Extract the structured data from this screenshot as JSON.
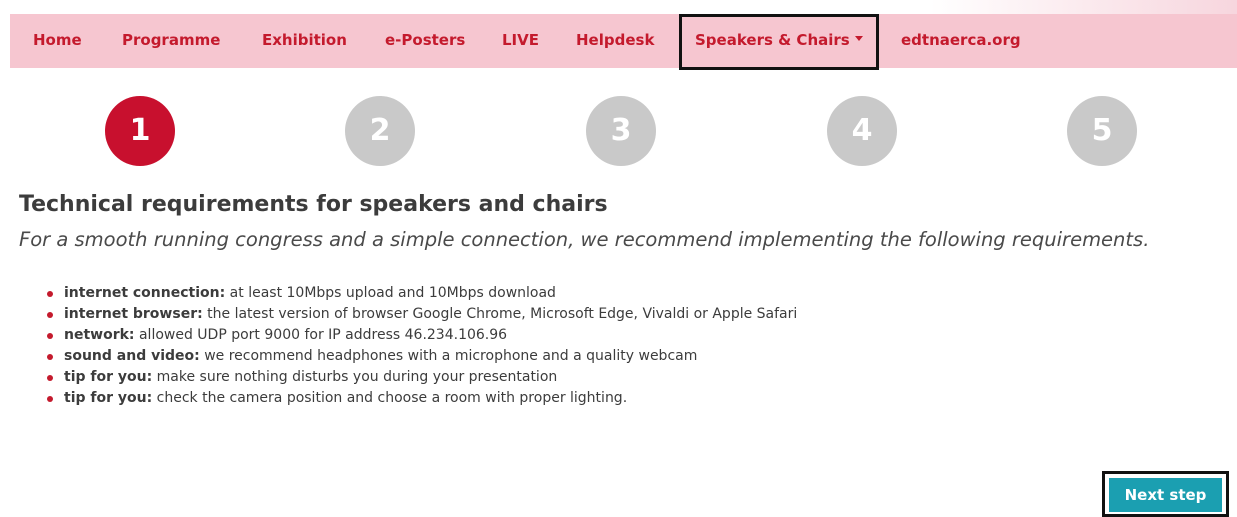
{
  "nav": {
    "items": [
      {
        "label": "Home"
      },
      {
        "label": "Programme"
      },
      {
        "label": "Exhibition"
      },
      {
        "label": "e-Posters"
      },
      {
        "label": "LIVE"
      },
      {
        "label": "Helpdesk"
      },
      {
        "label": "Speakers & Chairs",
        "active": true,
        "dropdown": true
      },
      {
        "label": "edtnaerca.org"
      }
    ]
  },
  "steps": {
    "items": [
      "1",
      "2",
      "3",
      "4",
      "5"
    ],
    "current": 1
  },
  "content": {
    "title": "Technical requirements for speakers and chairs",
    "subtitle": "For a smooth running congress and a simple connection, we recommend implementing the following requirements.",
    "requirements": [
      {
        "label": "internet connection:",
        "text": " at least 10Mbps upload and 10Mbps download"
      },
      {
        "label": "internet browser:",
        "text": " the latest version of browser Google Chrome, Microsoft Edge, Vivaldi or Apple Safari"
      },
      {
        "label": "network:",
        "text": " allowed UDP port 9000 for IP address 46.234.106.96"
      },
      {
        "label": "sound and video:",
        "text": " we recommend headphones with a microphone and a quality webcam"
      },
      {
        "label": "tip for you:",
        "text": " make sure nothing disturbs you during your presentation"
      },
      {
        "label": "tip for you:",
        "text": " check the camera position and choose a room with proper lighting."
      }
    ]
  },
  "buttons": {
    "next_label": "Next step"
  },
  "colors": {
    "brand_red": "#c41a2d",
    "nav_background": "#f6c6d0",
    "step_active": "#c8102e",
    "step_inactive": "#c9c9c9",
    "button_teal": "#1b9fb1"
  }
}
